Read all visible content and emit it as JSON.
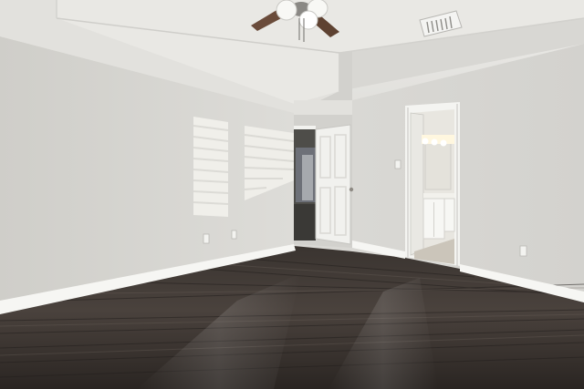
{
  "scene": {
    "subject": "empty-bedroom-interior",
    "elements": [
      "tray-ceiling",
      "ceiling-fan",
      "air-vent",
      "left-wall",
      "back-wall",
      "right-wall",
      "window-light-patches",
      "open-door-to-hall",
      "doorway-to-bathroom",
      "bathroom-vanity",
      "dark-wood-laminate-floor",
      "white-baseboards",
      "wall-outlets",
      "light-switch"
    ],
    "colors": {
      "wall": "#d6d5d1",
      "wall_shadow": "#c8c7c3",
      "ceiling": "#ebeae6",
      "floor_dark": "#2c2724",
      "floor_light": "#5b534d",
      "trim": "#f6f6f3",
      "door": "#f1f1ef",
      "vanity_light": "#fff7df"
    }
  }
}
